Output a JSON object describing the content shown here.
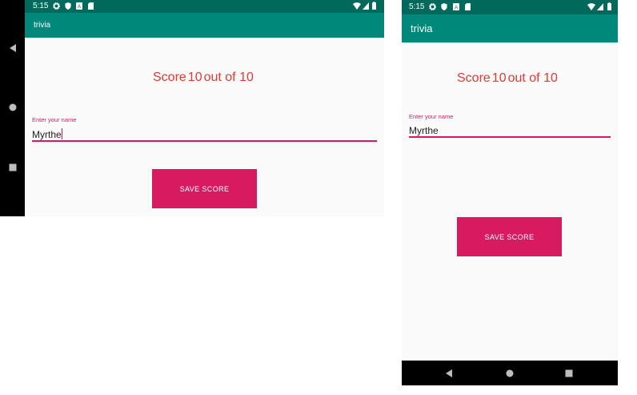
{
  "status_bar": {
    "time": "5:15"
  },
  "app": {
    "title": "trivia"
  },
  "score": {
    "prefix": "Score",
    "value": "10",
    "suffix": "out of 10"
  },
  "name_field": {
    "label": "Enter your name",
    "value": "Myrthe"
  },
  "save_button": {
    "label": "SAVE SCORE"
  },
  "colors": {
    "status_bar": "#00695c",
    "app_bar": "#00897b",
    "accent": "#d81b60",
    "score_text": "#e53935",
    "background": "#fafafa"
  }
}
